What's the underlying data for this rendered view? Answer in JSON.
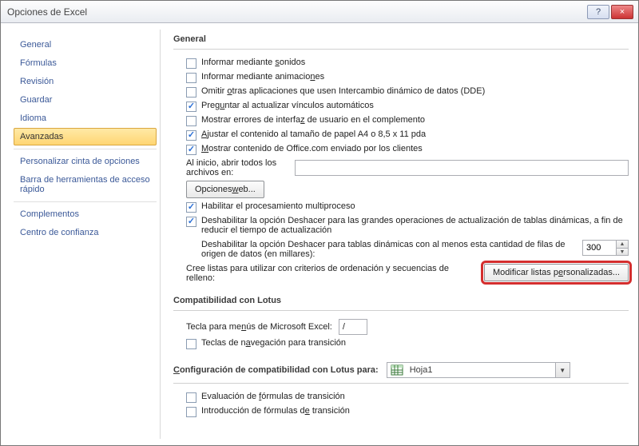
{
  "window": {
    "title": "Opciones de Excel",
    "help": "?",
    "close": "×"
  },
  "sidebar": {
    "items": [
      "General",
      "Fórmulas",
      "Revisión",
      "Guardar",
      "Idioma",
      "Avanzadas",
      "Personalizar cinta de opciones",
      "Barra de herramientas de acceso rápido",
      "Complementos",
      "Centro de confianza"
    ],
    "selected_index": 5
  },
  "general": {
    "title": "General",
    "chk_sounds": {
      "checked": false,
      "label_pre": "Informar mediante ",
      "u": "s",
      "label_post": "onidos"
    },
    "chk_animations": {
      "checked": false,
      "label_pre": "Informar mediante animacio",
      "u": "n",
      "label_post": "es"
    },
    "chk_dde": {
      "checked": false,
      "label_pre": "Omitir ",
      "u": "o",
      "label_post": "tras aplicaciones que usen Intercambio dinámico de datos (DDE)"
    },
    "chk_update_links": {
      "checked": true,
      "label_pre": "Preg",
      "u": "u",
      "label_post": "ntar al actualizar vínculos automáticos"
    },
    "chk_addin_errors": {
      "checked": false,
      "label_pre": "Mostrar errores de interfa",
      "u": "z",
      "label_post": " de usuario en el complemento"
    },
    "chk_a4": {
      "checked": true,
      "label_pre": "",
      "u": "A",
      "label_post": "justar el contenido al tamaño de papel A4 o 8,5 x 11 pda"
    },
    "chk_officecom": {
      "checked": true,
      "label_pre": "",
      "u": "M",
      "label_post": "ostrar contenido de Office.com enviado por los clientes"
    },
    "startup_label": "Al inicio, abrir todos los archivos en:",
    "startup_value": "",
    "btn_weboptions_pre": "Opciones ",
    "btn_weboptions_u": "w",
    "btn_weboptions_post": "eb...",
    "chk_multiproc": {
      "checked": true,
      "label_pre": "Habilitar el procesamiento multiproceso",
      "u": "",
      "label_post": ""
    },
    "chk_undo_refresh": {
      "checked": true,
      "label_pre": "Deshabilitar la opción Deshacer para las grandes operaciones de actualización de tablas dinámicas, a fin de reducir el tiempo de actualización",
      "u": "",
      "label_post": ""
    },
    "undo_rows_label": "Deshabilitar la opción Deshacer para tablas dinámicas con al menos esta cantidad de filas de origen de datos (en millares):",
    "undo_rows_value": "300",
    "custom_lists_label": "Cree listas para utilizar con criterios de ordenación y secuencias de relleno:",
    "btn_custom_lists_pre": "Modificar listas p",
    "btn_custom_lists_u": "e",
    "btn_custom_lists_post": "rsonalizadas..."
  },
  "lotus": {
    "title": "Compatibilidad con Lotus",
    "menu_key_label_pre": "Tecla para me",
    "menu_key_label_u": "n",
    "menu_key_label_post": "ús de Microsoft Excel:",
    "menu_key_value": "/",
    "chk_nav": {
      "checked": false,
      "label_pre": "Teclas de n",
      "u": "a",
      "label_post": "vegación para transición"
    }
  },
  "lotus_for": {
    "title_pre": "",
    "title_u": "C",
    "title_post": "onfiguración de compatibilidad con Lotus para:",
    "sheet": "Hoja1",
    "chk_formula_eval": {
      "checked": false,
      "label_pre": "Evaluación de ",
      "u": "f",
      "label_post": "órmulas de transición"
    },
    "chk_formula_entry": {
      "checked": false,
      "label_pre": "Introducción de fórmulas d",
      "u": "e",
      "label_post": " transición"
    }
  }
}
